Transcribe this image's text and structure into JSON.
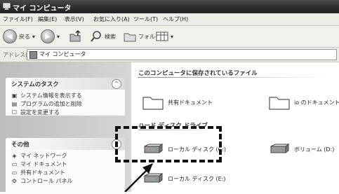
{
  "window": {
    "title": "マイ コンピュータ"
  },
  "menu": [
    "ファイル(F)",
    "編集(E)",
    "表示(V)",
    "お気に入り(A)",
    "ツール(T)",
    "ヘルプ(H)"
  ],
  "toolbar": {
    "back_label": "戻る",
    "search_label": "検索",
    "folders_label": "フォルダ"
  },
  "address": {
    "label": "アドレス(D)",
    "value": "マイ コンピュータ"
  },
  "system_tasks": {
    "title": "システムのタスク",
    "items": [
      "システム情報を表示する",
      "プログラムの追加と削除",
      "設定を変更する"
    ]
  },
  "other_places": {
    "title": "その他",
    "items": [
      "マイ ネットワーク",
      "マイ ドキュメント",
      "共有ドキュメント",
      "コントロール パネル"
    ]
  },
  "main": {
    "files_section": "このコンピュータに保存されているファイル",
    "folders": [
      "共有ドキュメント",
      "io のドキュメント"
    ],
    "drives_section": "ハード ディスク ドライブ",
    "drives": [
      "ローカル ディスク (C:)",
      "ボリューム (D:)",
      "ローカル ディスク (E:)"
    ]
  },
  "colors": {
    "highlight_border": "#111111",
    "titlebar": "#333333"
  }
}
